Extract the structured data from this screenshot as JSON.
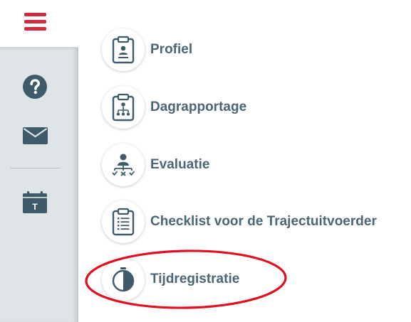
{
  "sidebar": {
    "menu_icon": "hamburger-menu-icon",
    "items": [
      {
        "icon": "help-icon"
      },
      {
        "icon": "mail-icon"
      },
      {
        "icon": "calendar-icon",
        "glyph": "T"
      }
    ]
  },
  "main": {
    "items": [
      {
        "label": "Profiel",
        "icon": "clipboard-profile-icon"
      },
      {
        "label": "Dagrapportage",
        "icon": "clipboard-hierarchy-icon"
      },
      {
        "label": "Evaluatie",
        "icon": "person-evaluation-icon"
      },
      {
        "label": "Checklist voor de Trajectuitvoerder",
        "icon": "clipboard-checklist-icon"
      },
      {
        "label": "Tijdregistratie",
        "icon": "timer-icon"
      }
    ]
  },
  "annotation": {
    "shape": "red-ellipse",
    "target": "Tijdregistratie",
    "color": "#e01020"
  },
  "colors": {
    "accent": "#d22a3f",
    "icon": "#3f5b6a",
    "label": "#4c6674",
    "sidebar": "#dfe4e6"
  }
}
